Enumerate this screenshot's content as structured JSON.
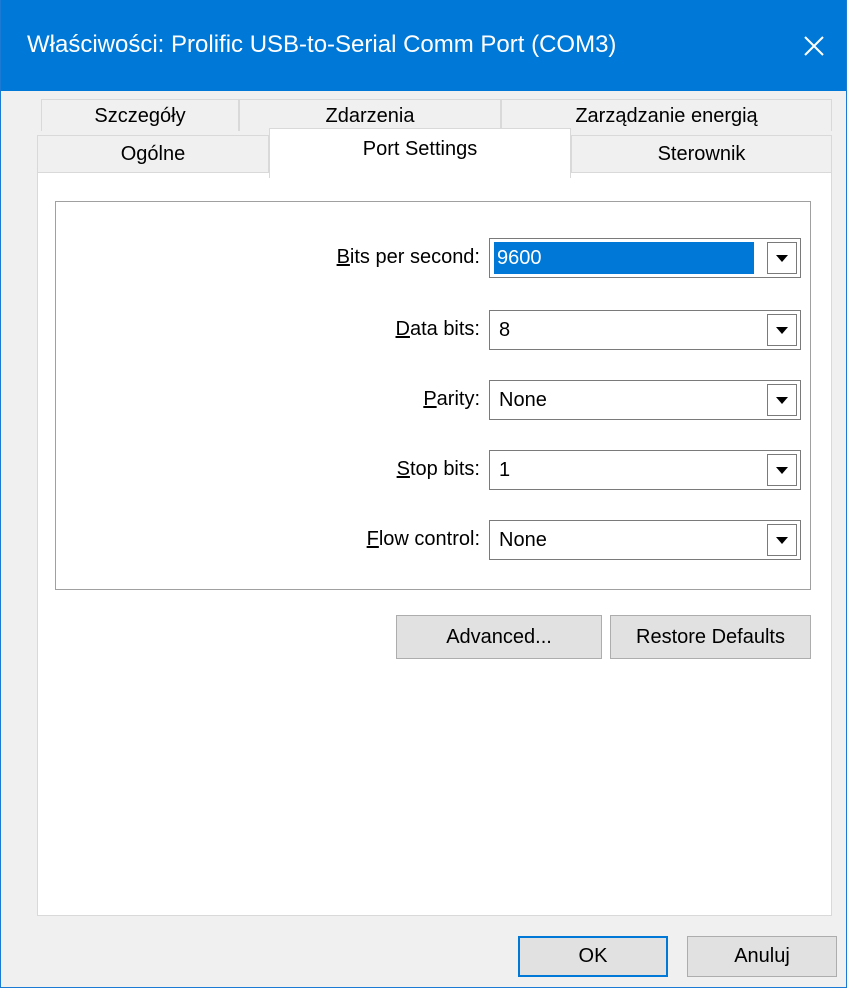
{
  "window": {
    "title": "Właściwości: Prolific USB-to-Serial Comm Port (COM3)",
    "close_icon": "close-icon"
  },
  "tabs": {
    "row1": [
      "Szczegóły",
      "Zdarzenia",
      "Zarządzanie energią"
    ],
    "row2": [
      "Ogólne",
      "Port Settings",
      "Sterownik"
    ],
    "active": "Port Settings"
  },
  "port_settings": {
    "bits_per_second": {
      "label": "Bits per second:",
      "mnemonic": "B",
      "value": "9600"
    },
    "data_bits": {
      "label": "Data bits:",
      "mnemonic": "D",
      "value": "8"
    },
    "parity": {
      "label": "Parity:",
      "mnemonic": "P",
      "value": "None"
    },
    "stop_bits": {
      "label": "Stop bits:",
      "mnemonic": "S",
      "value": "1"
    },
    "flow_control": {
      "label": "Flow control:",
      "mnemonic": "F",
      "value": "None"
    },
    "dropdown_icon": "dropdown-arrow-icon"
  },
  "buttons": {
    "advanced": "Advanced...",
    "restore_defaults": "Restore Defaults",
    "ok": "OK",
    "cancel": "Anuluj"
  },
  "colors": {
    "title_bar": "#0078d7",
    "selection": "#0078d7",
    "dialog_bg": "#f0f0f0",
    "panel_bg": "#ffffff"
  }
}
